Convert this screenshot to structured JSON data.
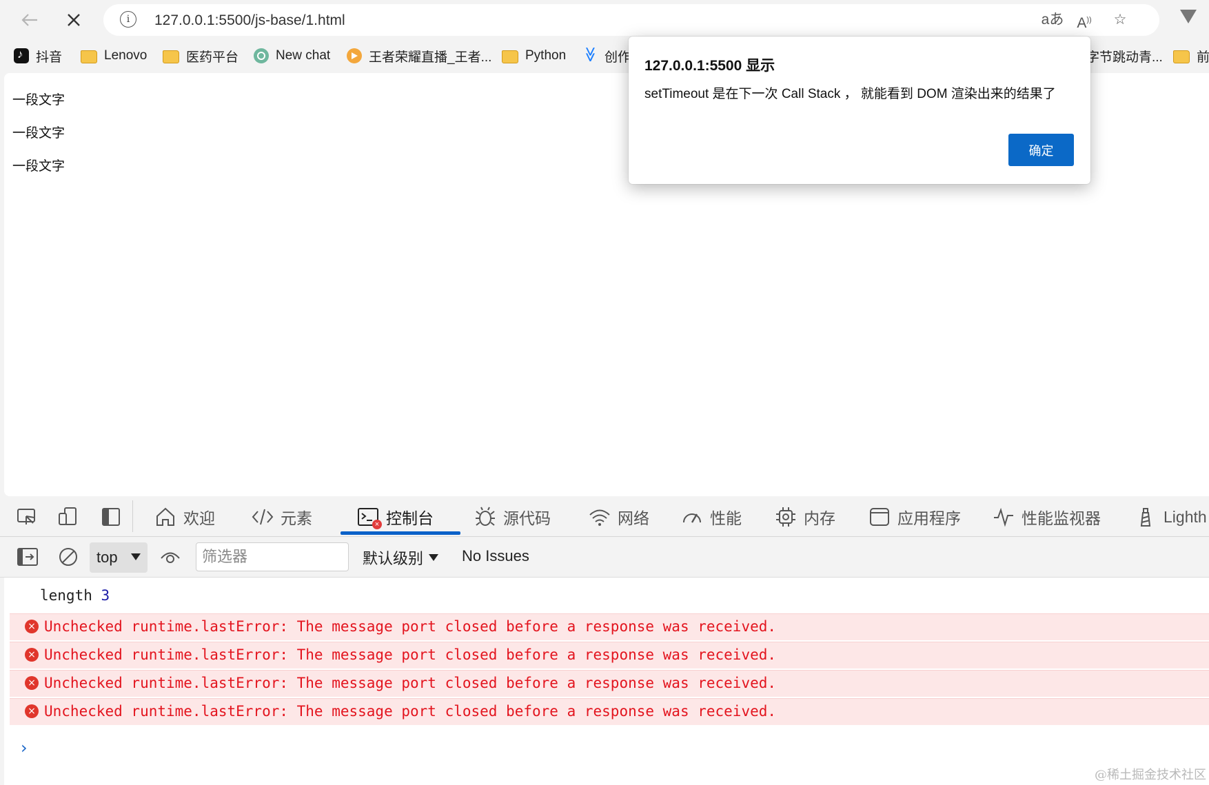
{
  "browser": {
    "url": "127.0.0.1:5500/js-base/1.html",
    "icons": [
      "back-arrow-icon",
      "close-icon",
      "info-icon",
      "translate-icon",
      "read-aloud-icon",
      "favorite-star-icon",
      "vivaldi-logo-icon"
    ]
  },
  "bookmarks": [
    {
      "label": "抖音",
      "icon": "tiktok-icon"
    },
    {
      "label": "Lenovo",
      "icon": "folder-icon"
    },
    {
      "label": "医药平台",
      "icon": "folder-icon"
    },
    {
      "label": "New chat",
      "icon": "chatgpt-icon"
    },
    {
      "label": "王者荣耀直播_王者...",
      "icon": "live-stream-icon"
    },
    {
      "label": "Python",
      "icon": "folder-icon"
    },
    {
      "label": "创作",
      "icon": "juejin-icon"
    },
    {
      "label": "字节跳动青...",
      "icon": ""
    },
    {
      "label": "前",
      "icon": "folder-icon"
    }
  ],
  "page": {
    "paragraphs": [
      "一段文字",
      "一段文字",
      "一段文字"
    ]
  },
  "dialog": {
    "title": "127.0.0.1:5500 显示",
    "message": "setTimeout 是在下一次 Call Stack ， 就能看到 DOM 渲染出来的结果了",
    "ok_label": "确定"
  },
  "devtools": {
    "tabs": [
      {
        "label": "欢迎",
        "icon": "home-icon"
      },
      {
        "label": "元素",
        "icon": "code-icon"
      },
      {
        "label": "控制台",
        "icon": "console-icon",
        "active": true
      },
      {
        "label": "源代码",
        "icon": "bug-icon"
      },
      {
        "label": "网络",
        "icon": "wifi-icon"
      },
      {
        "label": "性能",
        "icon": "speedometer-icon"
      },
      {
        "label": "内存",
        "icon": "chip-icon"
      },
      {
        "label": "应用程序",
        "icon": "app-window-icon"
      },
      {
        "label": "性能监视器",
        "icon": "pulse-icon"
      },
      {
        "label": "Lighth",
        "icon": "lighthouse-icon"
      }
    ],
    "toolbar": {
      "context": "top",
      "filter_placeholder": "筛选器",
      "levels": "默认级别",
      "issues": "No Issues"
    },
    "console": {
      "log_key": "length",
      "log_value": "3",
      "errors": [
        "Unchecked runtime.lastError: The message port closed before a response was received.",
        "Unchecked runtime.lastError: The message port closed before a response was received.",
        "Unchecked runtime.lastError: The message port closed before a response was received.",
        "Unchecked runtime.lastError: The message port closed before a response was received."
      ],
      "error_count_badge": "×"
    }
  },
  "watermark": "@稀土掘金技术社区",
  "colors": {
    "accent": "#0a61c8",
    "error": "#e3141e",
    "error_bg": "#fde7e7"
  }
}
